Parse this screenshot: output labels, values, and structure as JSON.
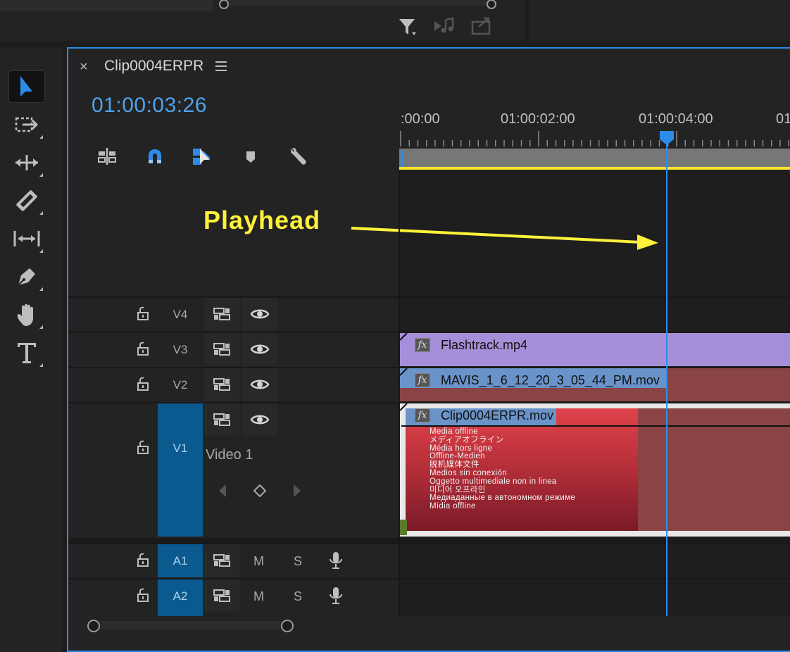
{
  "sequence": {
    "name": "Clip0004ERPR",
    "timecode": "01:00:03:26"
  },
  "ruler": {
    "labels": [
      ":00:00",
      "01:00:02:00",
      "01:00:04:00",
      "01"
    ]
  },
  "annotation": {
    "text": "Playhead",
    "color": "#fff23a"
  },
  "tracks": {
    "v4": {
      "label": "V4"
    },
    "v3": {
      "label": "V3"
    },
    "v2": {
      "label": "V2"
    },
    "v1": {
      "label": "V1",
      "display_name": "Video 1"
    },
    "a1": {
      "label": "A1",
      "mute": "M",
      "solo": "S"
    },
    "a2": {
      "label": "A2",
      "mute": "M",
      "solo": "S"
    }
  },
  "clips": {
    "flashtrack": {
      "fx": "fx",
      "name": "Flashtrack.mp4"
    },
    "mavis": {
      "fx": "fx",
      "name": "MAVIS_1_6_12_20_3_05_44_PM.mov"
    },
    "clip0004": {
      "fx": "fx",
      "name": "Clip0004ERPR.mov"
    }
  },
  "offline_text": [
    "Media offline",
    "メディアオフライン",
    "Média hors ligne",
    "Offline-Medien",
    "脱机媒体文件",
    "Medios sin conexión",
    "Oggetto multimediale non in linea",
    "미디어 오프라인",
    "Медиаданные в автономном режиме",
    "Mídia offline"
  ],
  "tools": [
    {
      "name": "selection-tool",
      "icon": "arrow"
    },
    {
      "name": "track-select-tool",
      "icon": "dashed-box-arrow"
    },
    {
      "name": "ripple-edit-tool",
      "icon": "ripple"
    },
    {
      "name": "razor-tool",
      "icon": "razor"
    },
    {
      "name": "slip-tool",
      "icon": "slip"
    },
    {
      "name": "pen-tool",
      "icon": "pen"
    },
    {
      "name": "hand-tool",
      "icon": "hand"
    },
    {
      "name": "type-tool",
      "icon": "T"
    }
  ],
  "colors": {
    "accent": "#2d8ceb",
    "timecode": "#4fa3ec",
    "v3_clip": "#a48fd8",
    "v2_clip": "#8a4444",
    "offline_red": "#c8303a",
    "work_area_bar": "#ffe62d"
  }
}
